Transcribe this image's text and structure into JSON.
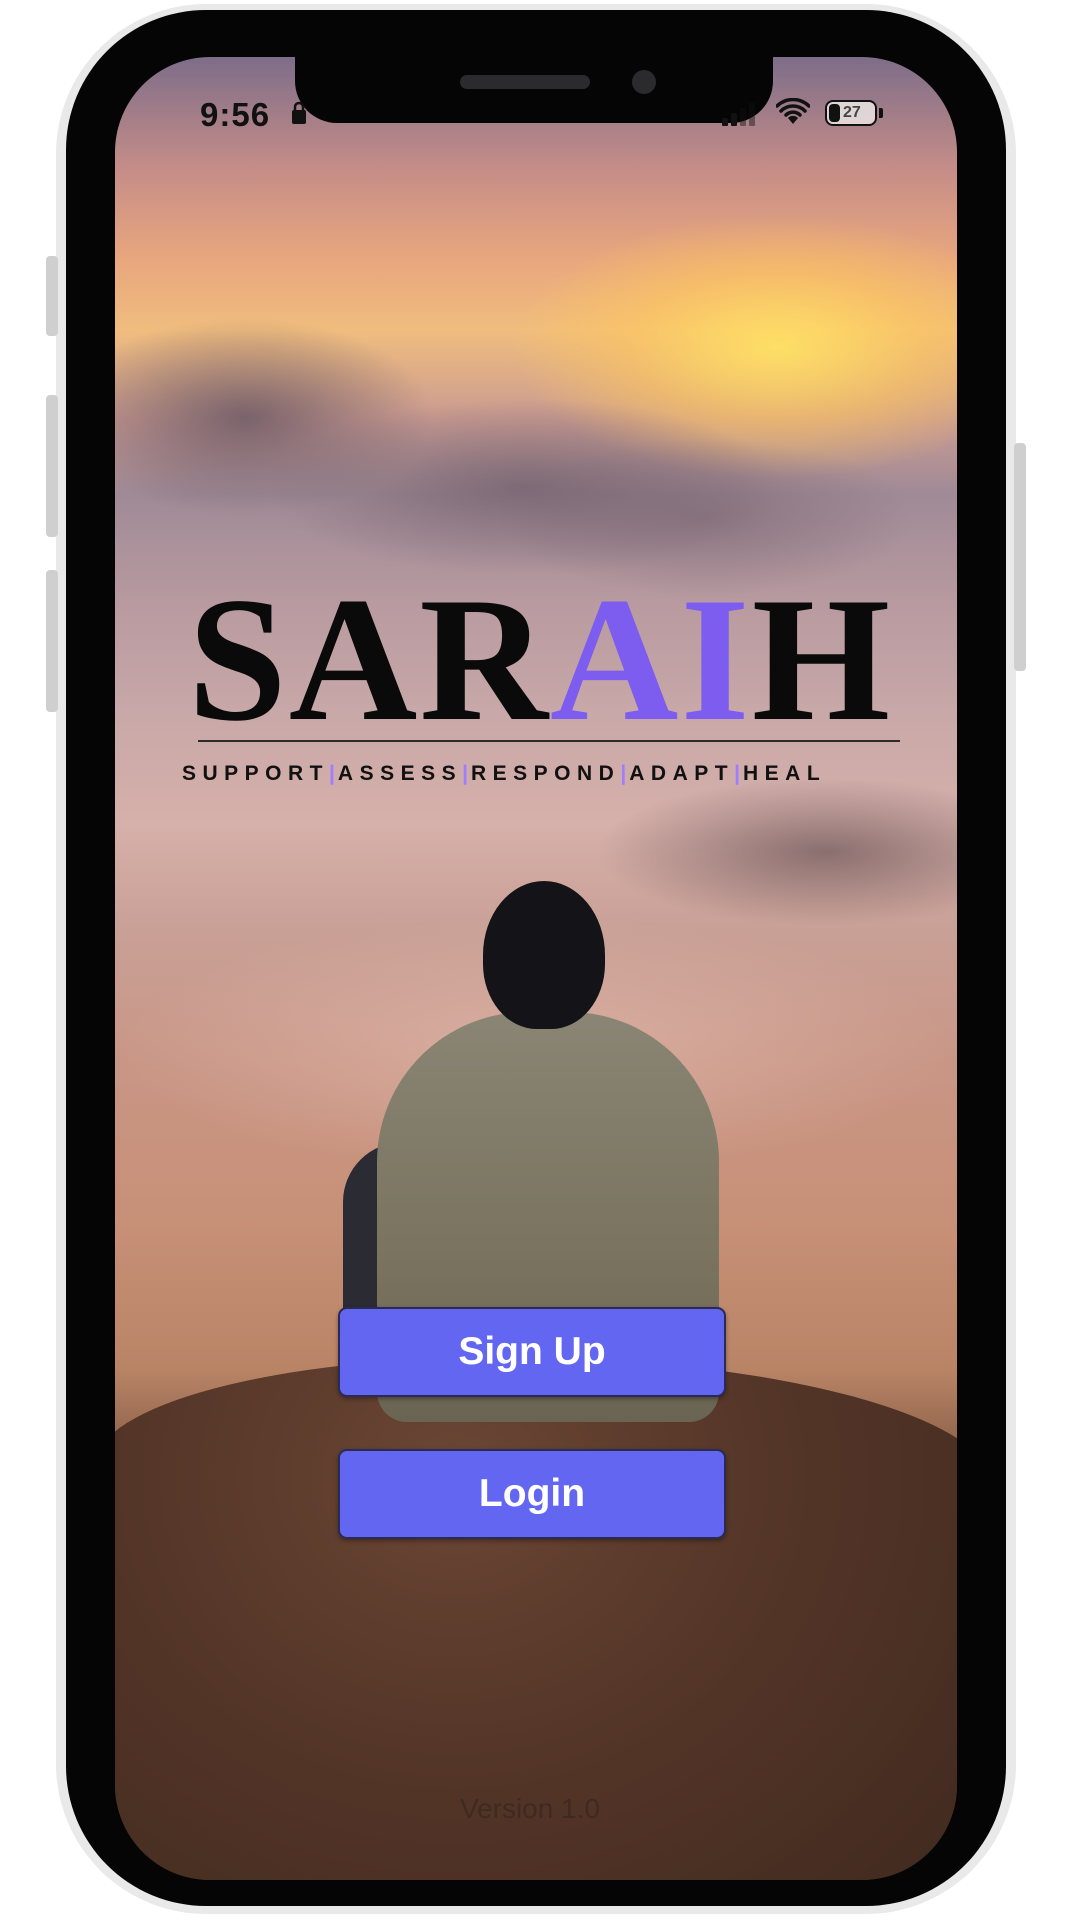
{
  "status_bar": {
    "time": "9:56",
    "battery": "27",
    "icons": [
      "lock-icon",
      "signal-icon",
      "wifi-icon",
      "battery-icon"
    ]
  },
  "logo": {
    "part1": "SAR",
    "accent": "AI",
    "part2": "H",
    "accent_color": "#7d5cf0"
  },
  "tagline": {
    "words": [
      "SUPPORT",
      "ASSESS",
      "RESPOND",
      "ADAPT",
      "HEAL"
    ],
    "separator": "|"
  },
  "buttons": {
    "signup": "Sign Up",
    "login": "Login",
    "color": "#6366f1"
  },
  "footer": {
    "version": "Version 1.0"
  }
}
